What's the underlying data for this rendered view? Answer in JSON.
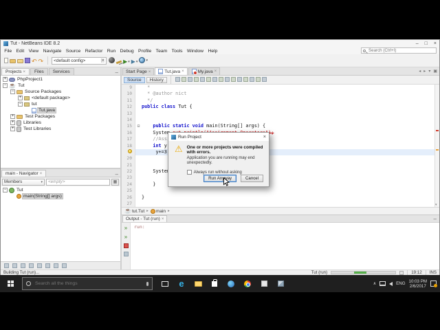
{
  "colors": {
    "accent": "#0078d7",
    "run_green": "#56b04a",
    "error_red": "#c40000",
    "warning": "#e9a700"
  },
  "window": {
    "title": "Tut - NetBeans IDE 8.2",
    "controls": {
      "minimize": "–",
      "maximize": "□",
      "close": "×"
    }
  },
  "menu": {
    "items": [
      "File",
      "Edit",
      "View",
      "Navigate",
      "Source",
      "Refactor",
      "Run",
      "Debug",
      "Profile",
      "Team",
      "Tools",
      "Window",
      "Help"
    ]
  },
  "toolbar": {
    "icons_left": [
      "new-file",
      "new-project",
      "open-project",
      "save-all",
      "undo",
      "redo"
    ],
    "config_value": "<default config>",
    "icons_right": [
      "clean-and-build",
      "build",
      "run",
      "debug-project",
      "profile"
    ],
    "search_placeholder": "Search (Ctrl+I)"
  },
  "projects_panel": {
    "tabs": [
      {
        "label": "Projects",
        "active": true,
        "closable": true
      },
      {
        "label": "Files"
      },
      {
        "label": "Services"
      }
    ],
    "minimize_glyph": "–",
    "tree": [
      {
        "label": "PhpProject1",
        "indent": 0,
        "icon": "php-project",
        "expander": "+"
      },
      {
        "label": "Tut",
        "indent": 0,
        "icon": "java-project",
        "expander": "-"
      },
      {
        "label": "Source Packages",
        "indent": 1,
        "icon": "source-folder",
        "expander": "-"
      },
      {
        "label": "<default package>",
        "indent": 2,
        "icon": "package",
        "expander": "+"
      },
      {
        "label": "tut",
        "indent": 2,
        "icon": "package",
        "expander": "-"
      },
      {
        "label": "Tut.java",
        "indent": 3,
        "icon": "java-file",
        "selected": true
      },
      {
        "label": "Test Packages",
        "indent": 1,
        "icon": "folder",
        "expander": "+"
      },
      {
        "label": "Libraries",
        "indent": 1,
        "icon": "libraries",
        "expander": "+"
      },
      {
        "label": "Test Libraries",
        "indent": 1,
        "icon": "libraries",
        "expander": "+"
      }
    ]
  },
  "navigator": {
    "tab": "main - Navigator",
    "mode": "Members",
    "filter_value": "<empty>",
    "tree": [
      {
        "label": "Tut",
        "indent": 0,
        "icon": "class",
        "expander": "-"
      },
      {
        "label": "main(String[] args)",
        "indent": 1,
        "icon": "method",
        "selected": true
      }
    ],
    "filters": [
      "show-inherited",
      "show-fields",
      "show-constructors",
      "show-methods",
      "show-static",
      "show-non-public",
      "sort-alpha",
      "sort-source"
    ]
  },
  "editor": {
    "tabs": [
      {
        "label": "Start Page"
      },
      {
        "label": "Tut.java",
        "icon": "java-file",
        "active": true
      },
      {
        "label": "My.java",
        "icon": "java-file-error"
      }
    ],
    "views": [
      "Source",
      "History"
    ],
    "tools": [
      "last-edited",
      "back",
      "forward",
      "find-selection",
      "find-occurrences",
      "toggle-highlight",
      "previous-occurrence",
      "next-occurrence",
      "toggle-bookmark",
      "shift-left",
      "shift-right",
      "start-macro",
      "stop-macro",
      "comment",
      "uncomment"
    ],
    "tab_controls": [
      "scroll-left",
      "scroll-right",
      "tab-list",
      "maximize"
    ],
    "code": [
      {
        "n": 9,
        "t": [
          [
            "c",
            "  *"
          ]
        ]
      },
      {
        "n": 10,
        "t": [
          [
            "c",
            "  * @author nict"
          ]
        ]
      },
      {
        "n": 11,
        "t": [
          [
            "c",
            "  */"
          ]
        ]
      },
      {
        "n": 12,
        "t": [
          [
            "k",
            "public class "
          ],
          [
            "p",
            "Tut {"
          ]
        ]
      },
      {
        "n": 13,
        "t": []
      },
      {
        "n": 14,
        "t": []
      },
      {
        "n": 15,
        "fold": true,
        "t": [
          [
            "k",
            "    public static void "
          ],
          [
            "p",
            "main(String[] args) {"
          ]
        ]
      },
      {
        "n": 16,
        "t": [
          [
            "p",
            "    System."
          ],
          [
            "e",
            "out.println(\"Assignment Operators\");"
          ]
        ]
      },
      {
        "n": 17,
        "t": [
          [
            "c",
            "    //Assignment Operators"
          ]
        ]
      },
      {
        "n": 18,
        "t": [
          [
            "k",
            "    int"
          ],
          [
            "p",
            " y = 10;"
          ]
        ]
      },
      {
        "n": 19,
        "hl": true,
        "bulb": true,
        "t": [
          [
            "p",
            "     y+=3;"
          ]
        ]
      },
      {
        "n": 20,
        "t": []
      },
      {
        "n": 21,
        "t": []
      },
      {
        "n": 22,
        "t": [
          [
            "p",
            "    System.out.println(y);"
          ]
        ]
      },
      {
        "n": 23,
        "t": []
      },
      {
        "n": 24,
        "t": [
          [
            "p",
            "    }"
          ]
        ]
      },
      {
        "n": 25,
        "t": []
      },
      {
        "n": 26,
        "t": [
          [
            "p",
            "}"
          ]
        ]
      },
      {
        "n": 27,
        "t": []
      }
    ],
    "breadcrumb": [
      {
        "label": "tut.Tut",
        "icon": "java-project"
      },
      {
        "label": "main",
        "icon": "method"
      }
    ]
  },
  "dialog": {
    "title": "Run Project",
    "message_bold": "One or more projects were compiled with errors.",
    "message": "Application you are running may end unexpectedly.",
    "checkbox_label": "Always run without asking",
    "run_button": "Run Anyway",
    "cancel_button": "Cancel"
  },
  "output": {
    "tab": "Output - Tut (run)",
    "actions": [
      "rerun",
      "rerun-debug",
      "stop",
      "clear"
    ],
    "text": "run:"
  },
  "statusbar": {
    "left": "Building Tut (run)...",
    "task_label": "Tut (run)",
    "progress_percent": 45,
    "caret_position": "19:12",
    "insert_mode": "INS"
  },
  "taskbar": {
    "search_placeholder": "Search all the things",
    "apps": [
      "task-view",
      "edge",
      "file-explorer",
      "store",
      "app-circle",
      "chrome",
      "photos",
      "virtualbox"
    ],
    "tray": {
      "language": "ENG",
      "time": "10:03 PM",
      "date": "2/6/2017"
    }
  }
}
